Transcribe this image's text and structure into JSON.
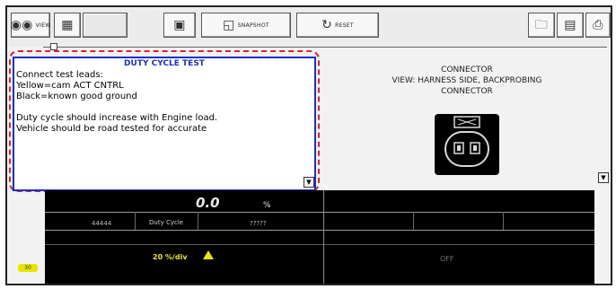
{
  "toolbar": {
    "view_label": "VIEW",
    "snapshot_label": "SNAPSHOT",
    "reset_label": "RESET"
  },
  "info_panel": {
    "title": "DUTY CYCLE TEST",
    "lines": [
      "Connect test leads:",
      "Yellow=cam ACT CNTRL",
      "Black=known good ground",
      "",
      "Duty cycle should increase with Engine load.",
      "Vehicle should be road tested for accurate"
    ]
  },
  "connector": {
    "title": "CONNECTOR",
    "subtitle": "VIEW: HARNESS SIDE, BACKPROBING",
    "subtitle2": "CONNECTOR"
  },
  "meter": {
    "reading": "0.0",
    "unit": "%",
    "left_ticks": "44444",
    "label": "Duty Cycle",
    "right_ticks": "?????",
    "scale": "20 %/div",
    "status": "OFF",
    "marker": "30"
  },
  "colors": {
    "panel_border": "#1a2fd0",
    "highlight_dash": "#e0202a",
    "trace": "#e8e600"
  }
}
